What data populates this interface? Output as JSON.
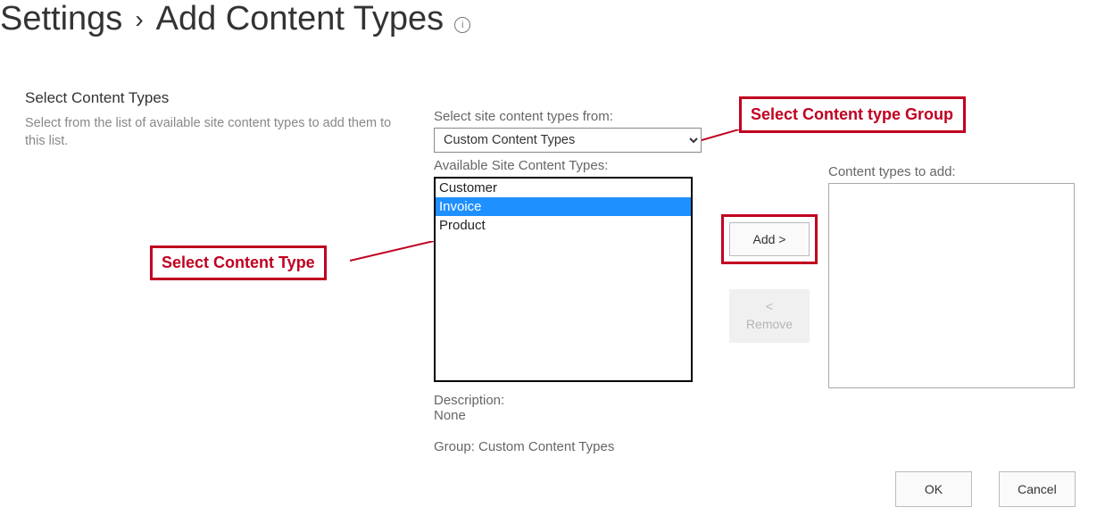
{
  "breadcrumb": {
    "root": "Settings",
    "separator": "›",
    "page": "Add Content Types"
  },
  "left": {
    "title": "Select Content Types",
    "description": "Select from the list of available site content types to add them to this list."
  },
  "form": {
    "select_from_label": "Select site content types from:",
    "group_selected": "Custom Content Types",
    "available_label": "Available Site Content Types:",
    "available_items": [
      "Customer",
      "Invoice",
      "Product"
    ],
    "selected_index": 1,
    "add_button": "Add >",
    "remove_button": "< Remove",
    "to_add_label": "Content types to add:",
    "description_label": "Description:",
    "description_value": "None",
    "group_label": "Group: Custom Content Types"
  },
  "footer": {
    "ok": "OK",
    "cancel": "Cancel"
  },
  "annotations": {
    "group_callout": "Select Content type Group",
    "type_callout": "Select Content Type"
  }
}
